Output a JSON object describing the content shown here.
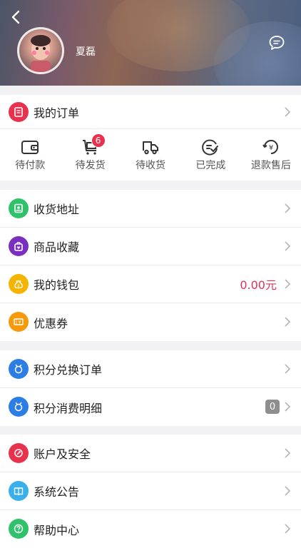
{
  "user": {
    "name": "夏磊"
  },
  "order_header": {
    "label": "我的订单"
  },
  "order_status": [
    {
      "label": "待付款",
      "icon": "wallet-icon"
    },
    {
      "label": "待发货",
      "icon": "cart-icon",
      "badge": "6"
    },
    {
      "label": "待收货",
      "icon": "truck-icon"
    },
    {
      "label": "已完成",
      "icon": "checklist-icon"
    },
    {
      "label": "退款售后",
      "icon": "refund-icon"
    }
  ],
  "menu_group1": [
    {
      "label": "收货地址",
      "icon": "address-icon",
      "color": "#2fc26a"
    },
    {
      "label": "商品收藏",
      "icon": "favorite-bag-icon",
      "color": "#7a2fbf"
    },
    {
      "label": "我的钱包",
      "icon": "wallet-bag-icon",
      "color": "#f4b400",
      "value": "0.00元"
    },
    {
      "label": "优惠券",
      "icon": "coupon-icon",
      "color": "#f59a0b"
    }
  ],
  "menu_group2": [
    {
      "label": "积分兑换订单",
      "icon": "points-order-icon",
      "color": "#2a7ee6"
    },
    {
      "label": "积分消费明细",
      "icon": "points-detail-icon",
      "color": "#2a7ee6",
      "badge": "0"
    }
  ],
  "menu_group3": [
    {
      "label": "账户及安全",
      "icon": "security-icon",
      "color": "#e8314c"
    },
    {
      "label": "系统公告",
      "icon": "notice-icon",
      "color": "#39b0ec"
    },
    {
      "label": "帮助中心",
      "icon": "help-icon",
      "color": "#2fc26a"
    }
  ]
}
